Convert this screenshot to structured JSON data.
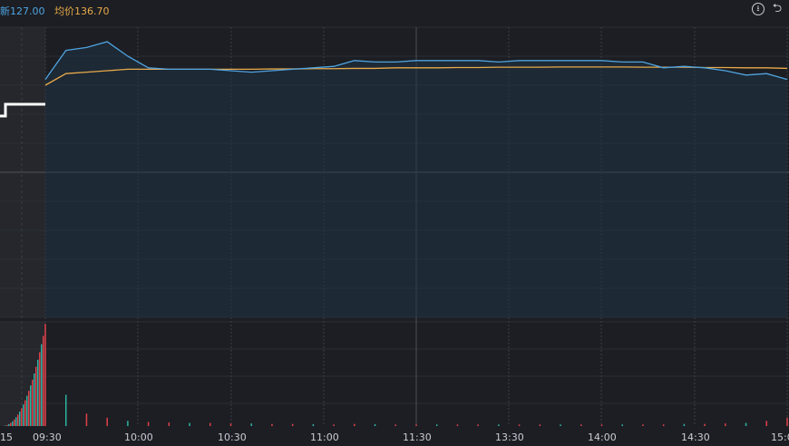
{
  "header": {
    "latest_label": "新127.00",
    "avg_label": "均价136.70"
  },
  "icons": {
    "download": "download-icon",
    "back": "back-icon"
  },
  "colors": {
    "background": "#1c1e23",
    "price_line": "#4fa3e0",
    "avg_line": "#e8a94a",
    "pre_market_line": "#ffffff",
    "up_bar": "#e0404a",
    "down_bar": "#2fb3a3"
  },
  "chart_data": {
    "type": "line",
    "x_ticks": [
      "15",
      "09:30",
      "10:00",
      "10:30",
      "11:00",
      "11:30",
      "13:30",
      "14:00",
      "14:30",
      "15:0"
    ],
    "session": [
      "09:30",
      "09:45",
      "09:50",
      "09:55",
      "09:58",
      "10:00",
      "10:05",
      "10:10",
      "10:15",
      "10:20",
      "10:25",
      "10:30",
      "10:40",
      "10:50",
      "11:00",
      "11:05",
      "11:10",
      "11:15",
      "11:20",
      "11:30",
      "13:05",
      "13:10",
      "13:20",
      "13:30",
      "13:40",
      "13:50",
      "14:00",
      "14:10",
      "14:20",
      "14:25",
      "14:30",
      "14:35",
      "14:40",
      "14:45",
      "14:50",
      "14:55",
      "15:00"
    ],
    "price_norm": [
      0.82,
      0.92,
      0.93,
      0.95,
      0.9,
      0.86,
      0.855,
      0.855,
      0.855,
      0.85,
      0.845,
      0.85,
      0.855,
      0.86,
      0.865,
      0.885,
      0.88,
      0.88,
      0.885,
      0.885,
      0.885,
      0.885,
      0.88,
      0.885,
      0.885,
      0.885,
      0.885,
      0.885,
      0.88,
      0.88,
      0.86,
      0.865,
      0.86,
      0.85,
      0.835,
      0.84,
      0.82
    ],
    "avg_norm": [
      0.8,
      0.84,
      0.845,
      0.85,
      0.855,
      0.855,
      0.855,
      0.855,
      0.855,
      0.855,
      0.855,
      0.856,
      0.856,
      0.857,
      0.857,
      0.858,
      0.858,
      0.86,
      0.86,
      0.86,
      0.861,
      0.861,
      0.862,
      0.862,
      0.862,
      0.863,
      0.863,
      0.863,
      0.863,
      0.862,
      0.862,
      0.862,
      0.861,
      0.861,
      0.86,
      0.86,
      0.858
    ],
    "volume_norm": [
      0.98,
      0.3,
      0.12,
      0.08,
      0.05,
      0.04,
      0.035,
      0.03,
      0.03,
      0.025,
      0.025,
      0.02,
      0.02,
      0.018,
      0.015,
      0.02,
      0.018,
      0.015,
      0.015,
      0.015,
      0.015,
      0.015,
      0.015,
      0.015,
      0.015,
      0.015,
      0.015,
      0.015,
      0.015,
      0.015,
      0.015,
      0.02,
      0.02,
      0.025,
      0.03,
      0.05,
      0.08
    ]
  }
}
